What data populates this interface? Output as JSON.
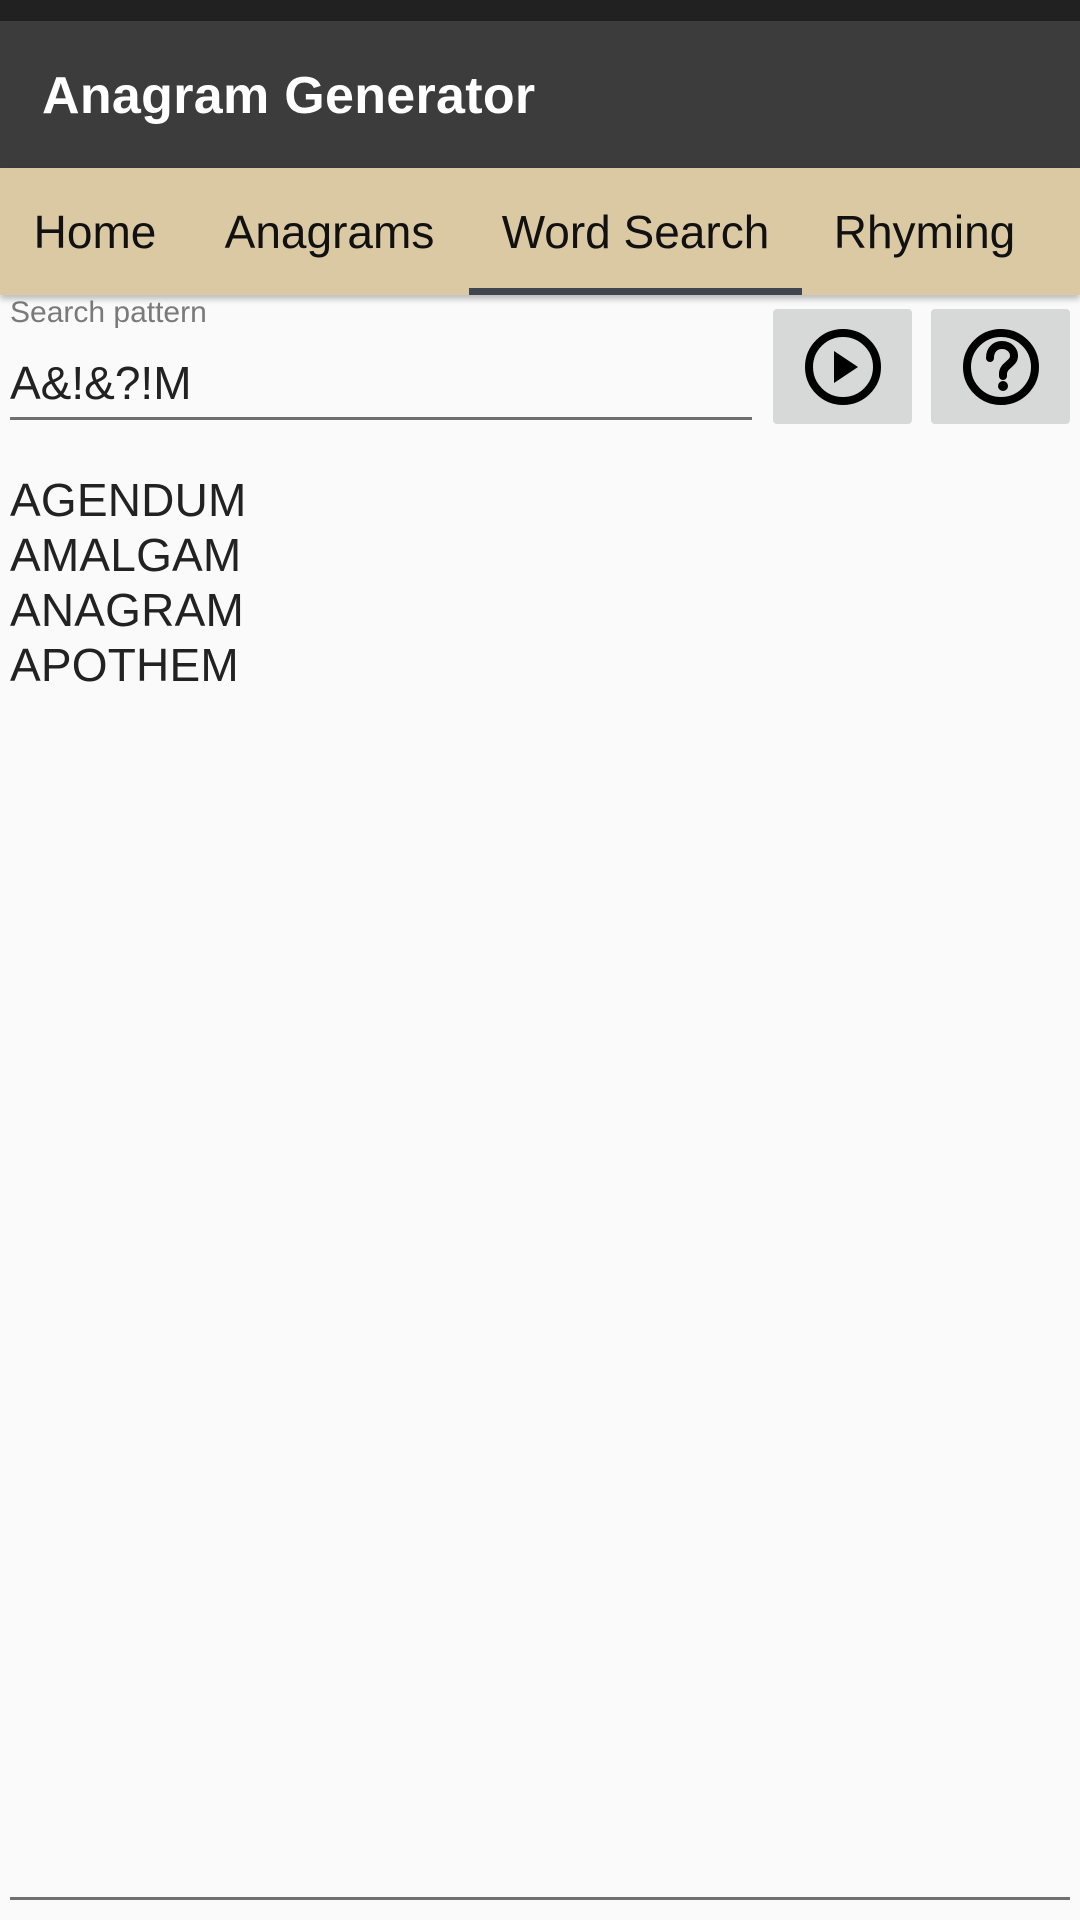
{
  "app": {
    "title": "Anagram Generator"
  },
  "tabs": [
    {
      "label": "Home",
      "active": false
    },
    {
      "label": "Anagrams",
      "active": false
    },
    {
      "label": "Word Search",
      "active": true
    },
    {
      "label": "Rhyming",
      "active": false
    }
  ],
  "search": {
    "label": "Search pattern",
    "value": "A&!&?!M"
  },
  "buttons": {
    "run_icon": "play-circle-icon",
    "help_icon": "help-circle-icon"
  },
  "results": [
    "AGENDUM",
    "AMALGAM",
    "ANAGRAM",
    "APOTHEM"
  ],
  "colors": {
    "app_bar": "#3c3c3c",
    "tab_bar": "#dbc9a3",
    "tab_indicator": "#42474f",
    "button_bg": "#d7d8d8"
  }
}
